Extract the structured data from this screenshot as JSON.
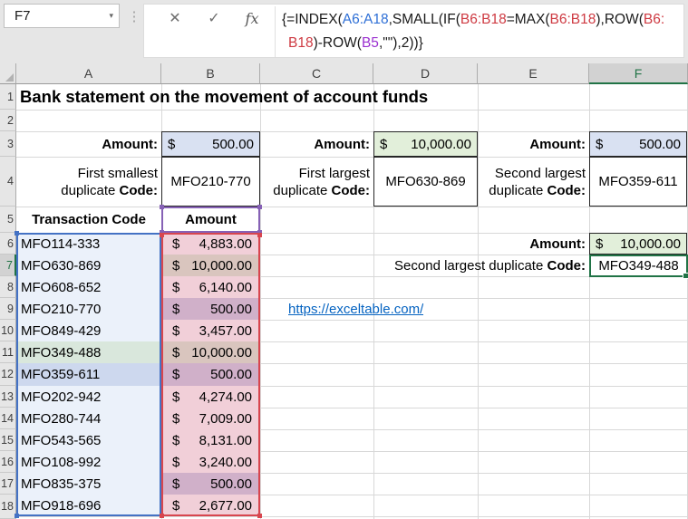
{
  "formula_bar": {
    "cell_reference": "F7",
    "parts": [
      "{=INDEX(",
      "A6:A18",
      ",SMALL(IF(",
      "B6:B18",
      "=MAX(",
      "B6:B18",
      "),ROW(",
      "B6:",
      "B18",
      ")-ROW(",
      "B5",
      ",\"\"),2))}"
    ]
  },
  "icons": {
    "cancel": "✕",
    "enter": "✓",
    "insert_function": "fx",
    "name_box_dropdown": "▾",
    "more_dots": "⋮"
  },
  "colors": {
    "accent_green": "#217346",
    "ref_blue": "#4472C4",
    "ref_red": "#D8454E",
    "ref_purple": "#8661B5",
    "fill_lavender": "#D9E1F2",
    "fill_green": "#E2EFDA",
    "link": "#0563C1"
  },
  "column_headers": [
    "A",
    "B",
    "C",
    "D",
    "E",
    "F"
  ],
  "row_headers": [
    "1",
    "2",
    "3",
    "4",
    "5",
    "6",
    "7",
    "8",
    "9",
    "10",
    "11",
    "12",
    "13",
    "14",
    "15",
    "16",
    "17",
    "18"
  ],
  "title": "Bank statement on the movement of account funds",
  "summary": {
    "smallest": {
      "amount_label": "Amount:",
      "currency": "$",
      "amount": "500.00",
      "label_line1": "First smallest",
      "label_line2": "duplicate",
      "label_bold": "Code:",
      "code": "MFO210-770"
    },
    "largest": {
      "amount_label": "Amount:",
      "currency": "$",
      "amount": "10,000.00",
      "label_line1": "First largest",
      "label_line2": "duplicate",
      "label_bold": "Code:",
      "code": "MFO630-869"
    },
    "second_largest": {
      "amount_label": "Amount:",
      "currency": "$",
      "amount": "500.00",
      "label_line1": "Second largest",
      "label_line2": "duplicate",
      "label_bold": "Code:",
      "code": "MFO359-611"
    },
    "second_largest_duplicate": {
      "amount_label": "Amount:",
      "currency": "$",
      "amount": "10,000.00",
      "label": "Second largest duplicate",
      "label_bold": "Code:",
      "code": "MFO349-488"
    }
  },
  "hyperlink": {
    "text": "https://exceltable.com/"
  },
  "table": {
    "code_header": "Transaction Code",
    "amount_header": "Amount",
    "currency": "$",
    "rows": [
      {
        "code": "MFO114-333",
        "amount": "4,883.00"
      },
      {
        "code": "MFO630-869",
        "amount": "10,000.00"
      },
      {
        "code": "MFO608-652",
        "amount": "6,140.00"
      },
      {
        "code": "MFO210-770",
        "amount": "500.00"
      },
      {
        "code": "MFO849-429",
        "amount": "3,457.00"
      },
      {
        "code": "MFO349-488",
        "amount": "10,000.00"
      },
      {
        "code": "MFO359-611",
        "amount": "500.00"
      },
      {
        "code": "MFO202-942",
        "amount": "4,274.00"
      },
      {
        "code": "MFO280-744",
        "amount": "7,009.00"
      },
      {
        "code": "MFO543-565",
        "amount": "8,131.00"
      },
      {
        "code": "MFO108-992",
        "amount": "3,240.00"
      },
      {
        "code": "MFO835-375",
        "amount": "500.00"
      },
      {
        "code": "MFO918-696",
        "amount": "2,677.00"
      }
    ]
  }
}
